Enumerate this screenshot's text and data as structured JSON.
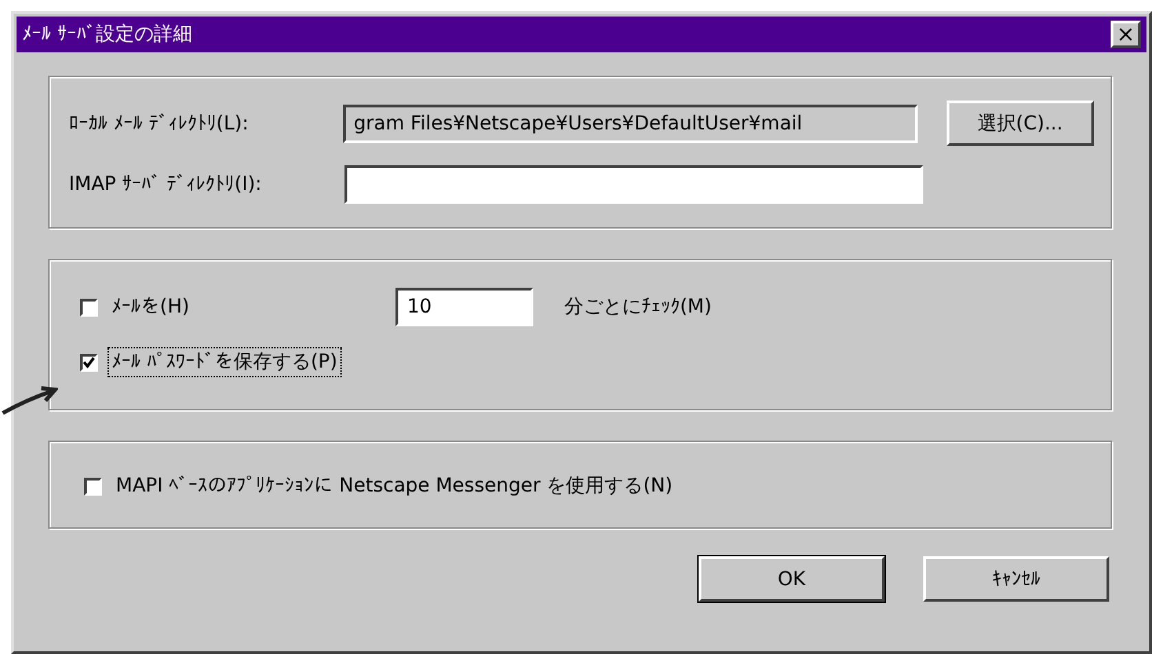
{
  "window": {
    "title": "ﾒｰﾙ ｻｰﾊﾞ設定の詳細",
    "close": "×"
  },
  "directories": {
    "local": {
      "label": "ﾛｰｶﾙ ﾒｰﾙ ﾃﾞｨﾚｸﾄﾘ(L):",
      "value": "gram Files¥Netscape¥Users¥DefaultUser¥mail",
      "disabled": true,
      "button": "選択(C)..."
    },
    "imap": {
      "label": "IMAP ｻｰﾊﾞ ﾃﾞｨﾚｸﾄﾘ(I):"
    }
  },
  "check_mail": {
    "label": "ﾒｰﾙを(H)",
    "checked": false,
    "minutes": "10",
    "suffix": "分ごとにﾁｪｯｸ(M)"
  },
  "save_password": {
    "label": "ﾒｰﾙ ﾊﾟｽﾜｰﾄﾞを保存する(P)",
    "checked": true,
    "focused": true
  },
  "mapi": {
    "label": "MAPI ﾍﾞｰｽのｱﾌﾟﾘｹｰｼｮﾝに Netscape Messenger を使用する(N)",
    "checked": false
  },
  "buttons": [
    {
      "label": "OK",
      "default": true
    },
    {
      "label": "ｷｬﾝｾﾙ",
      "default": false
    }
  ]
}
